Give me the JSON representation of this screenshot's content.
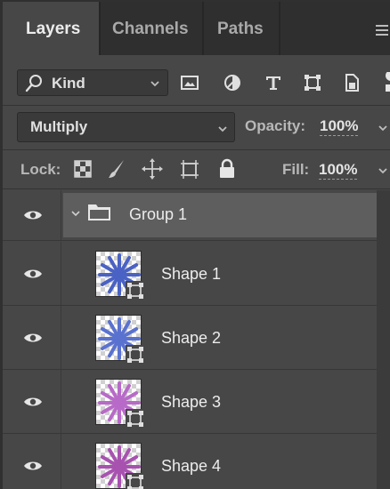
{
  "tabs": [
    {
      "label": "Layers",
      "active": true
    },
    {
      "label": "Channels",
      "active": false
    },
    {
      "label": "Paths",
      "active": false
    }
  ],
  "filter": {
    "kind_label": "Kind",
    "icons": [
      "pixel-layer-filter-icon",
      "adjustment-layer-filter-icon",
      "type-layer-filter-icon",
      "shape-layer-filter-icon",
      "smart-object-filter-icon",
      "filter-toggle-icon"
    ]
  },
  "blend": {
    "mode": "Multiply",
    "opacity_label": "Opacity:",
    "opacity_value": "100%"
  },
  "lock": {
    "label": "Lock:",
    "icons": [
      "lock-transparent-pixels-icon",
      "lock-image-pixels-icon",
      "lock-position-icon",
      "lock-artboard-icon",
      "lock-all-icon"
    ],
    "fill_label": "Fill:",
    "fill_value": "100%"
  },
  "layers": {
    "group": {
      "name": "Group 1",
      "expanded": true,
      "visible": true
    },
    "items": [
      {
        "name": "Shape 1",
        "visible": true,
        "color": "#4a62c4"
      },
      {
        "name": "Shape 2",
        "visible": true,
        "color": "#5a72cf"
      },
      {
        "name": "Shape 3",
        "visible": true,
        "color": "#b86ac8"
      },
      {
        "name": "Shape 4",
        "visible": true,
        "color": "#a852b0"
      }
    ]
  },
  "colors": {
    "panel_bg": "#474747",
    "tab_bar_bg": "#2f2f2f",
    "group_selected_bg": "#5e5e5e",
    "text_primary": "#ececec"
  }
}
